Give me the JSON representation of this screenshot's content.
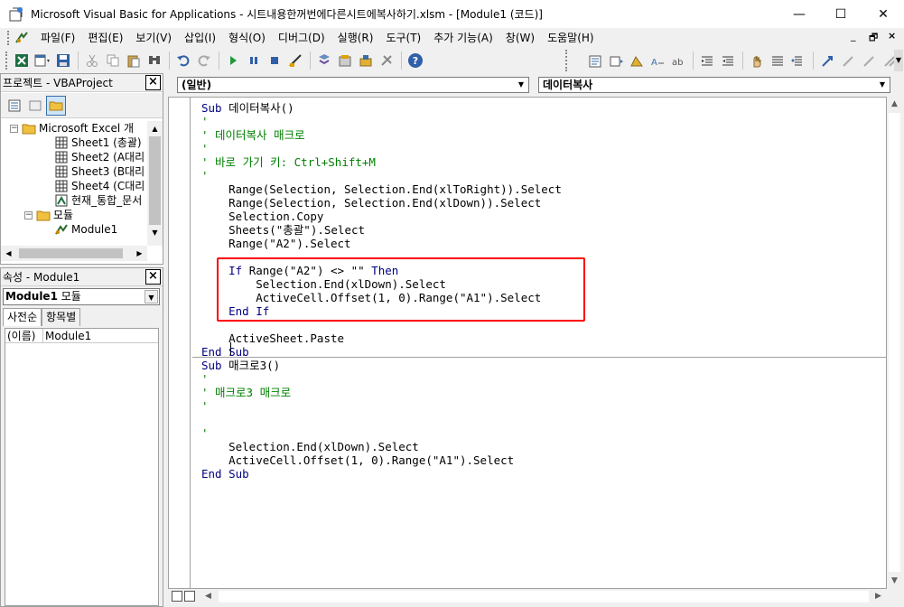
{
  "window": {
    "title": "Microsoft Visual Basic for Applications - 시트내용한꺼번에다른시트에복사하기.xlsm - [Module1 (코드)]",
    "minimize": "—",
    "maximize": "☐",
    "close": "✕"
  },
  "menu": [
    "파일(F)",
    "편집(E)",
    "보기(V)",
    "삽입(I)",
    "형식(O)",
    "디버그(D)",
    "실행(R)",
    "도구(T)",
    "추가 기능(A)",
    "창(W)",
    "도움말(H)"
  ],
  "menu_mdi": {
    "min": "_",
    "restore": "🗗",
    "close": "×"
  },
  "project_pane": {
    "title": "프로젝트 - VBAProject",
    "close": "×",
    "tree": [
      {
        "label": "Microsoft Excel 개",
        "kind": "folder",
        "expander": "−"
      },
      {
        "label": "Sheet1 (총괄)",
        "kind": "sheet"
      },
      {
        "label": "Sheet2 (A대리",
        "kind": "sheet"
      },
      {
        "label": "Sheet3 (B대리",
        "kind": "sheet"
      },
      {
        "label": "Sheet4 (C대리",
        "kind": "sheet"
      },
      {
        "label": "현재_통합_문서",
        "kind": "workbook"
      },
      {
        "label": "모듈",
        "kind": "folder",
        "expander": "−"
      },
      {
        "label": "Module1",
        "kind": "module"
      }
    ]
  },
  "properties_pane": {
    "title": "속성 - Module1",
    "close": "×",
    "object_name": "Module1",
    "object_type": " 모듈",
    "tabs": [
      "사전순",
      "항목별"
    ],
    "rows": [
      {
        "key": "(이름)",
        "value": "Module1"
      }
    ]
  },
  "code_window": {
    "object_combo": "(일반)",
    "proc_combo": "데이터복사",
    "lines": [
      {
        "segments": [
          {
            "t": "Sub ",
            "c": "kw"
          },
          {
            "t": "데이터복사()",
            "c": ""
          }
        ]
      },
      {
        "segments": [
          {
            "t": "'",
            "c": "cm"
          }
        ]
      },
      {
        "segments": [
          {
            "t": "' 데이터복사 매크로",
            "c": "cm"
          }
        ]
      },
      {
        "segments": [
          {
            "t": "'",
            "c": "cm"
          }
        ]
      },
      {
        "segments": [
          {
            "t": "' 바로 가기 키: Ctrl+Shift+M",
            "c": "cm"
          }
        ]
      },
      {
        "segments": [
          {
            "t": "'",
            "c": "cm"
          }
        ]
      },
      {
        "segments": [
          {
            "t": "    Range(Selection, Selection.End(xlToRight)).Select",
            "c": ""
          }
        ]
      },
      {
        "segments": [
          {
            "t": "    Range(Selection, Selection.End(xlDown)).Select",
            "c": ""
          }
        ]
      },
      {
        "segments": [
          {
            "t": "    Selection.Copy",
            "c": ""
          }
        ]
      },
      {
        "segments": [
          {
            "t": "    Sheets(\"총괄\").Select",
            "c": ""
          }
        ]
      },
      {
        "segments": [
          {
            "t": "    Range(\"A2\").Select",
            "c": ""
          }
        ]
      },
      {
        "segments": [
          {
            "t": "",
            "c": ""
          }
        ]
      },
      {
        "segments": [
          {
            "t": "    ",
            "c": ""
          },
          {
            "t": "If",
            "c": "kw"
          },
          {
            "t": " Range(\"A2\") <> \"\" ",
            "c": ""
          },
          {
            "t": "Then",
            "c": "kw"
          }
        ]
      },
      {
        "segments": [
          {
            "t": "        Selection.End(xlDown).Select",
            "c": ""
          }
        ]
      },
      {
        "segments": [
          {
            "t": "        ActiveCell.Offset(1, 0).Range(\"A1\").Select",
            "c": ""
          }
        ]
      },
      {
        "segments": [
          {
            "t": "    ",
            "c": ""
          },
          {
            "t": "End If",
            "c": "kw"
          }
        ]
      },
      {
        "segments": [
          {
            "t": "",
            "c": ""
          }
        ]
      },
      {
        "segments": [
          {
            "t": "    ActiveSheet.Paste",
            "c": ""
          }
        ]
      },
      {
        "segments": [
          {
            "t": "End Sub",
            "c": "kw"
          }
        ]
      },
      {
        "segments": [
          {
            "t": "Sub ",
            "c": "kw"
          },
          {
            "t": "매크로3()",
            "c": ""
          }
        ]
      },
      {
        "segments": [
          {
            "t": "'",
            "c": "cm"
          }
        ]
      },
      {
        "segments": [
          {
            "t": "' 매크로3 매크로",
            "c": "cm"
          }
        ]
      },
      {
        "segments": [
          {
            "t": "'",
            "c": "cm"
          }
        ]
      },
      {
        "segments": [
          {
            "t": "",
            "c": ""
          }
        ]
      },
      {
        "segments": [
          {
            "t": "'",
            "c": "cm"
          }
        ]
      },
      {
        "segments": [
          {
            "t": "    Selection.End(xlDown).Select",
            "c": ""
          }
        ]
      },
      {
        "segments": [
          {
            "t": "    ActiveCell.Offset(1, 0).Range(\"A1\").Select",
            "c": ""
          }
        ]
      },
      {
        "segments": [
          {
            "t": "End Sub",
            "c": "kw"
          }
        ]
      }
    ]
  },
  "colors": {
    "keyword": "#000080",
    "comment": "#008000",
    "highlight_box": "#ff0000"
  },
  "icons": {
    "toolbar": [
      "excel-icon",
      "insert-module-icon",
      "save-icon",
      "cut-icon",
      "copy-icon",
      "paste-icon",
      "find-icon",
      "undo-icon",
      "redo-icon",
      "run-icon",
      "break-icon",
      "reset-icon",
      "design-mode-icon",
      "project-explorer-icon",
      "properties-window-icon",
      "object-browser-icon",
      "toolbox-icon",
      "help-icon"
    ]
  }
}
